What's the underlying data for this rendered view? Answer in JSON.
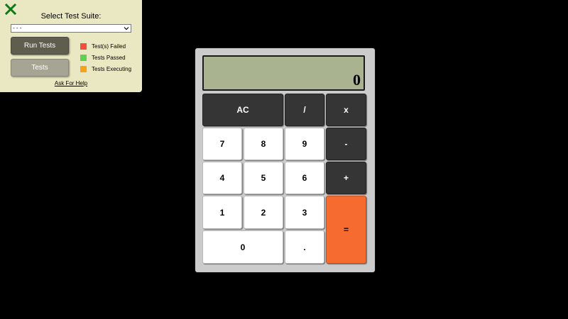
{
  "test_panel": {
    "title": "Select Test Suite:",
    "suite_select_value": "- - -",
    "run_button": "Run Tests",
    "tests_button": "Tests",
    "legend": [
      {
        "label": "Test(s) Failed",
        "color": "#f2503b"
      },
      {
        "label": "Tests Passed",
        "color": "#5fd14f"
      },
      {
        "label": "Tests Executing",
        "color": "#f6a21a"
      }
    ],
    "help_link": "Ask For Help",
    "close_icon_color": "#0d7a18"
  },
  "calculator": {
    "display": "0",
    "keys": {
      "clear": "AC",
      "divide": "/",
      "multiply": "x",
      "subtract": "-",
      "add": "+",
      "equals": "=",
      "decimal": ".",
      "d0": "0",
      "d1": "1",
      "d2": "2",
      "d3": "3",
      "d4": "4",
      "d5": "5",
      "d6": "6",
      "d7": "7",
      "d8": "8",
      "d9": "9"
    },
    "colors": {
      "operator": "#353535",
      "digit": "#ffffff",
      "equals": "#f56b30",
      "display": "#a9b38f"
    }
  }
}
